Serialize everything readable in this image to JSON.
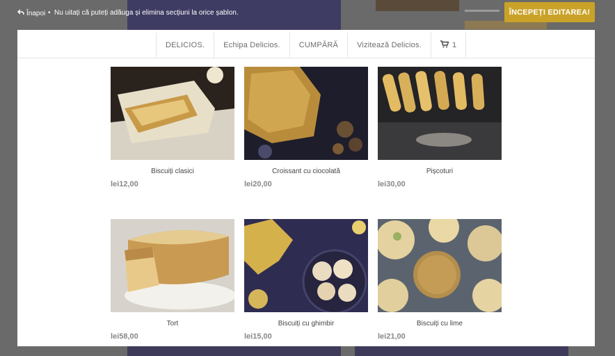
{
  "editor": {
    "back_label": "Înapoi",
    "separator": "•",
    "notice": "Nu uitați că puteți adăuga și elimina secțiuni la orice șablon.",
    "start_button": "ÎNCEPEȚI EDITAREA!"
  },
  "nav": {
    "items": [
      {
        "label": "DELICIOS."
      },
      {
        "label": "Echipa Delicios."
      },
      {
        "label": "CUMPĂRĂ"
      },
      {
        "label": "Vizitează Delicios."
      }
    ],
    "cart_icon": "cart-icon",
    "cart_count": "1"
  },
  "products": [
    {
      "name": "Biscuiți clasici",
      "price": "lei12,00"
    },
    {
      "name": "Croissant cu ciocolată",
      "price": "lei20,00"
    },
    {
      "name": "Pișcoturi",
      "price": "lei30,00"
    },
    {
      "name": "Tort",
      "price": "lei58,00"
    },
    {
      "name": "Biscuiți cu ghimbir",
      "price": "lei15,00"
    },
    {
      "name": "Biscuiți cu lime",
      "price": "lei21,00"
    }
  ],
  "colors": {
    "accent": "#c9a227",
    "overlay": "#6a6a6a"
  }
}
